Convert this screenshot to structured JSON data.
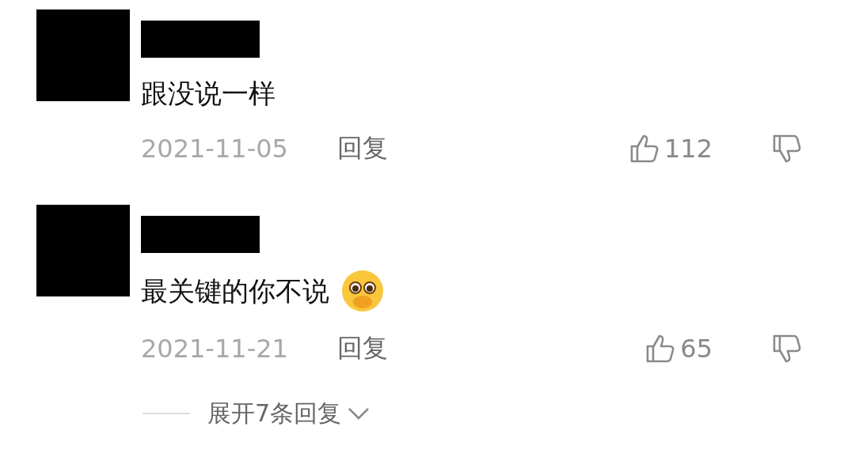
{
  "comments": [
    {
      "text": "跟没说一样",
      "emoji": false,
      "date": "2021-11-05",
      "reply": "回复",
      "likes": "112"
    },
    {
      "text": "最关键的你不说",
      "emoji": true,
      "date": "2021-11-21",
      "reply": "回复",
      "likes": "65"
    }
  ],
  "expand": {
    "label": "展开7条回复"
  }
}
